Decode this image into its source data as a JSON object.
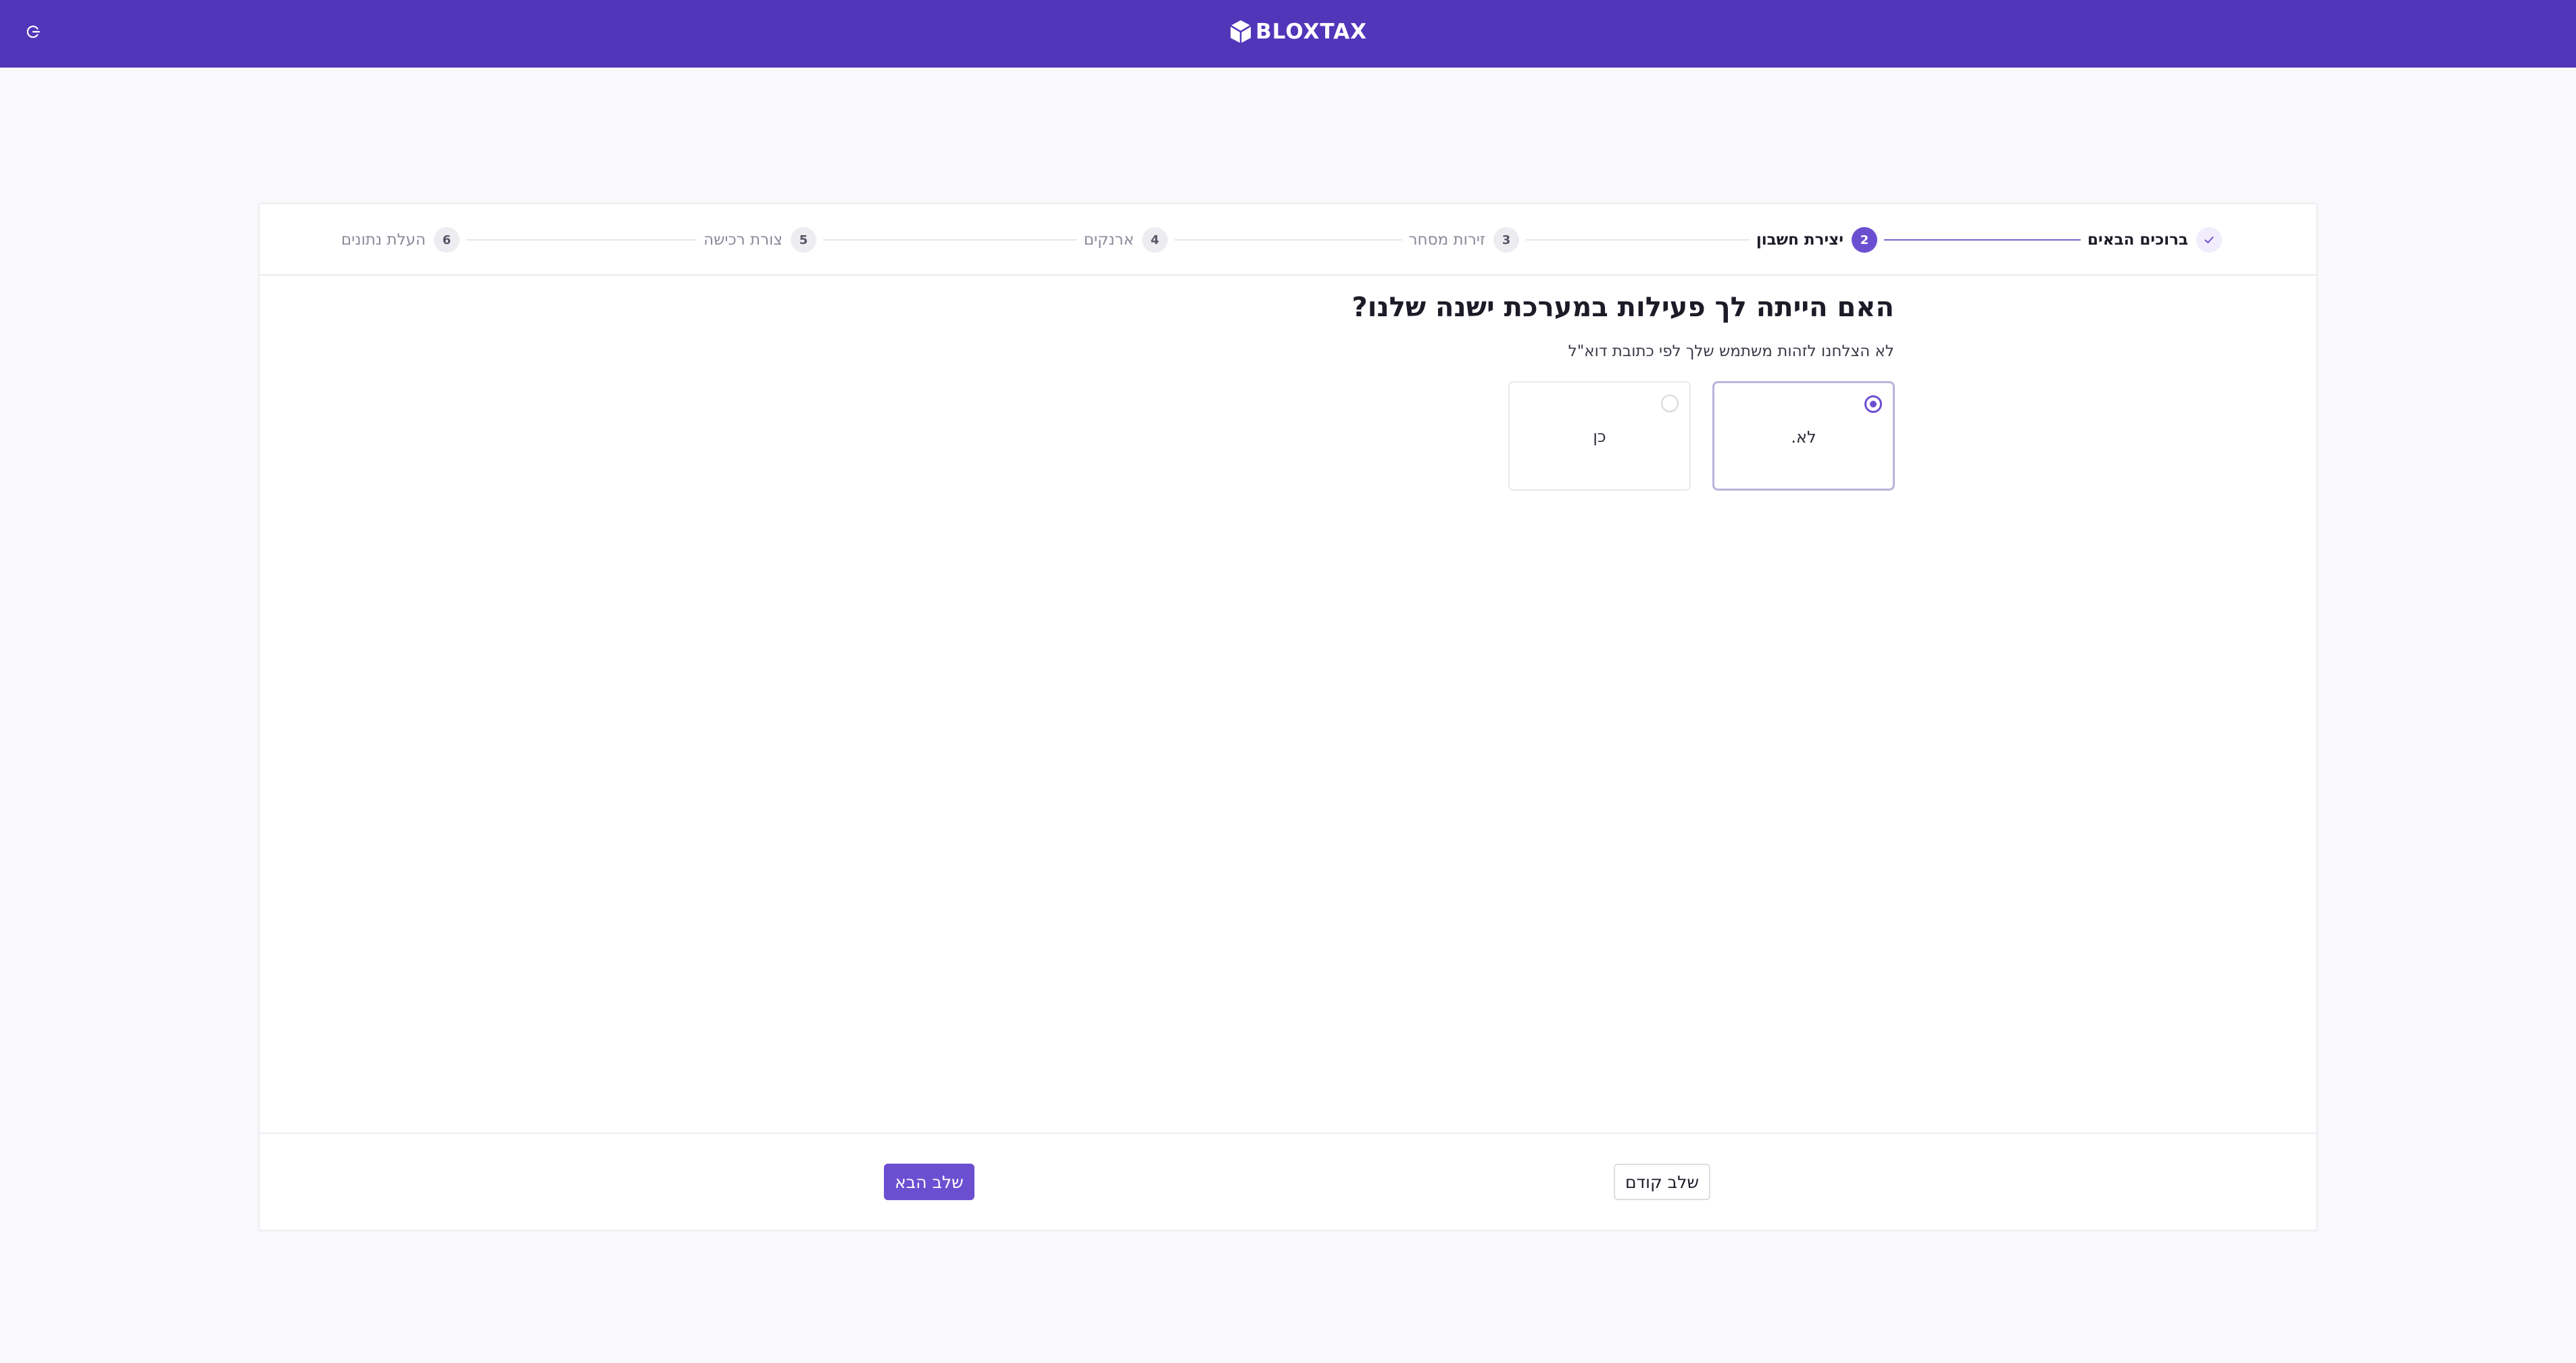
{
  "header": {
    "brand": "BLOXTAX",
    "logout_icon": "logout-icon"
  },
  "steps": [
    {
      "number": "✓",
      "label": "ברוכים הבאים",
      "state": "done"
    },
    {
      "number": "2",
      "label": "יצירת חשבון",
      "state": "active"
    },
    {
      "number": "3",
      "label": "זירות מסחר",
      "state": "pending"
    },
    {
      "number": "4",
      "label": "ארנקים",
      "state": "pending"
    },
    {
      "number": "5",
      "label": "צורת רכישה",
      "state": "pending"
    },
    {
      "number": "6",
      "label": "העלת נתונים",
      "state": "pending"
    }
  ],
  "main": {
    "question": "האם הייתה לך פעילות במערכת ישנה שלנו?",
    "subtitle": "לא הצלחנו לזהות משתמש שלך לפי כתובת דוא\"ל",
    "options": [
      {
        "label": "לא.",
        "selected": true
      },
      {
        "label": "כן",
        "selected": false
      }
    ]
  },
  "footer": {
    "prev_label": "שלב קודם",
    "next_label": "שלב הבא"
  },
  "colors": {
    "brand": "#5236ba",
    "accent": "#6c4fd1"
  }
}
